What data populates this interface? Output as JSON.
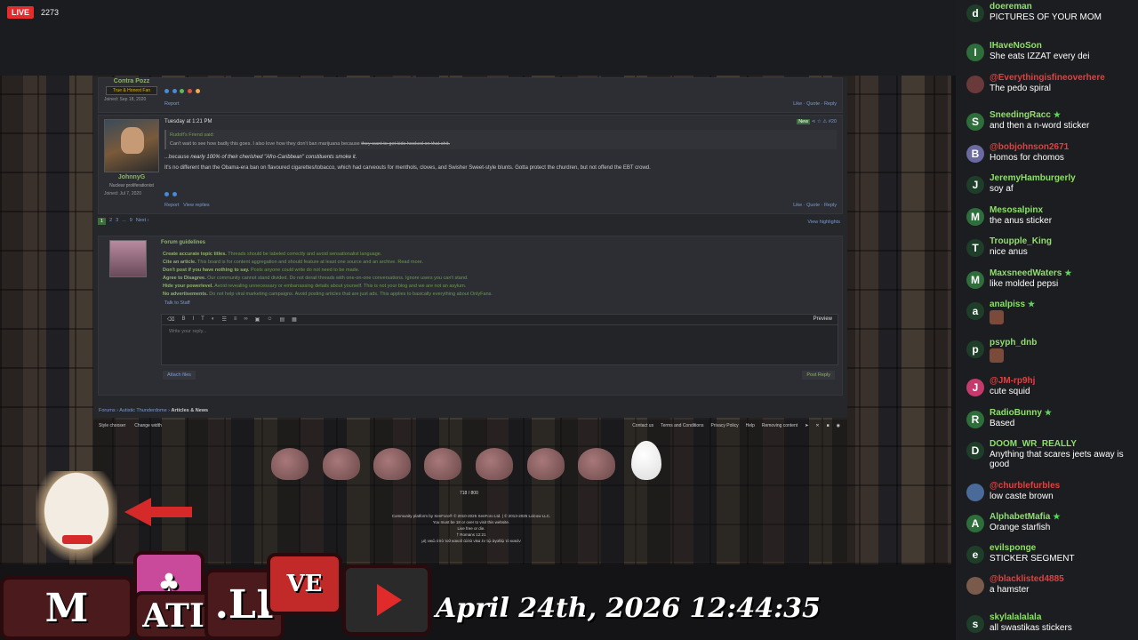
{
  "stream": {
    "live_label": "LIVE",
    "viewer_count": "2273",
    "datetime": "April 24th, 2026 12:44:35",
    "logo_letters": [
      "M",
      "ATI",
      ".LI",
      "VE"
    ]
  },
  "forum": {
    "post1": {
      "username": "Contra Pozz",
      "role": "True & Honest Fan",
      "joined_label": "Joined:",
      "joined_date": "Sep 18, 2020",
      "report": "Report",
      "like": "Like",
      "quote": "Quote",
      "reply": "Reply"
    },
    "post2": {
      "username": "JohnnyG",
      "role": "Nuclear proliferationist",
      "joined_label": "Joined:",
      "joined_date": "Jul 7, 2020",
      "timestamp": "Tuesday at 1:21 PM",
      "badge": "New",
      "number": "#20",
      "quote_from": "Rudolf's Friend said:",
      "quote_text_plain": "Can't wait to see how badly this goes. I also love how they don't ban marijuana because ",
      "quote_text_strike": "they want to get kids hooked on that shit.",
      "line1_prefix": "...because ",
      "line1_italic": "nearly 100% of their cherished \"Afro-Caribbean\" constituents smoke it.",
      "line2": "It's no different than the Obama-era ban on flavoured cigarettes/tobacco, which had carveouts for menthols, cloves, and Swisher Sweet-style blunts. Gotta protect the churdren, but not offend the EBT crowd.",
      "report": "Report",
      "view_replies": "View replies",
      "like": "Like",
      "quote": "Quote",
      "reply": "Reply"
    },
    "pager": [
      "1",
      "2",
      "3",
      "...",
      "9",
      "Next ›"
    ],
    "view_highlights": "View highlights",
    "guidelines": {
      "title": "Forum guidelines",
      "items": [
        {
          "head": "Create accurate topic titles.",
          "text": "Threads should be labeled correctly and avoid sensationalist language."
        },
        {
          "head": "Cite an article.",
          "text": "This board is for content aggregation and should feature at least one source and an archive. Read more."
        },
        {
          "head": "Don't post if you have nothing to say.",
          "text": "Posts anyone could write do not need to be made."
        },
        {
          "head": "Agree to Disagree.",
          "text": "Our community cannot stand divided. Do not derail threads with one-on-one conversations. Ignore users you can't stand."
        },
        {
          "head": "Hide your powerlevel.",
          "text": "Avoid revealing unnecessary or embarrassing details about yourself. This is not your blog and we are not an asylum."
        },
        {
          "head": "No advertisements.",
          "text": "Do not help viral marketing campaigns. Avoid posting articles that are just ads. This applies to basically everything about OnlyFans."
        }
      ],
      "talk_to_staff": "Talk to Staff"
    },
    "editor": {
      "placeholder": "Write your reply...",
      "preview": "Preview",
      "attach": "Attach files",
      "post_reply": "Post Reply"
    },
    "breadcrumbs": [
      "Forums",
      "Autistic Thunderdome",
      "Articles & News"
    ]
  },
  "footer": {
    "left_links": [
      "Style chooser",
      "Change width"
    ],
    "right_links": [
      "Contact us",
      "Terms and Conditions",
      "Privacy Policy",
      "Help",
      "Removing content"
    ],
    "counter": "718 / 800",
    "legal": [
      "Community platform by XenForo® © 2010-2025 XenForo Ltd. | © 2013-2025 Lolcow LLC.",
      "You must be 18 or over to visit this website.",
      "Live free or die.",
      "† Romans 12:21",
      "μὴ νικῶ ὑπὸ τοῦ κακοῦ ἀλλὰ νίκα ἐν τῷ ἀγαθῷ τὸ κακόν"
    ]
  },
  "chat": [
    {
      "initial": "d",
      "name": "doereman",
      "text": "PICTURES OF YOUR MOM",
      "name_color": "green",
      "star": false,
      "avatar_color": "#1e3e2a"
    },
    {
      "initial": "I",
      "name": "IHaveNoSon",
      "text": "She eats IZZAT every dei",
      "name_color": "green",
      "star": false,
      "avatar_color": "#2d6e3a"
    },
    {
      "initial": "",
      "name": "@Everythingisfineoverhere",
      "text": "The pedo spiral",
      "name_color": "red",
      "star": false,
      "avatar_color": "#6a3a3a"
    },
    {
      "initial": "S",
      "name": "SneedingRacc",
      "text": "and then a n-word sticker",
      "name_color": "green",
      "star": true,
      "avatar_color": "#2d6e3a"
    },
    {
      "initial": "B",
      "name": "@bobjohnson2671",
      "text": "Homos for chomos",
      "name_color": "red",
      "star": false,
      "avatar_color": "#6a6aa0"
    },
    {
      "initial": "J",
      "name": "JeremyHamburgerly",
      "text": "soy af",
      "name_color": "green",
      "star": false,
      "avatar_color": "#1e3e2a"
    },
    {
      "initial": "M",
      "name": "Mesosalpinx",
      "text": "the anus sticker",
      "name_color": "green",
      "star": false,
      "avatar_color": "#2d6e3a"
    },
    {
      "initial": "T",
      "name": "Troupple_King",
      "text": "nice anus",
      "name_color": "green",
      "star": false,
      "avatar_color": "#1e3e2a"
    },
    {
      "initial": "M",
      "name": "MaxsneedWaters",
      "text": "like molded pepsi",
      "name_color": "green",
      "star": true,
      "avatar_color": "#2d6e3a"
    },
    {
      "initial": "a",
      "name": "analpiss",
      "text": "",
      "name_color": "green",
      "star": true,
      "avatar_color": "#1e3e2a"
    },
    {
      "initial": "p",
      "name": "psyph_dnb",
      "text": "",
      "name_color": "green",
      "star": false,
      "avatar_color": "#1e3e2a"
    },
    {
      "initial": "J",
      "name": "@JM-rp9hj",
      "text": "cute squid",
      "name_color": "red",
      "star": false,
      "avatar_color": "#c43a6a"
    },
    {
      "initial": "R",
      "name": "RadioBunny",
      "text": "Based",
      "name_color": "green",
      "star": true,
      "avatar_color": "#2d6e3a"
    },
    {
      "initial": "D",
      "name": "DOOM_WR_REALLY",
      "text": "Anything that scares jeets away is good",
      "name_color": "green",
      "star": false,
      "avatar_color": "#1e3e2a"
    },
    {
      "initial": "",
      "name": "@churblefurbles",
      "text": "low caste brown",
      "name_color": "red",
      "star": false,
      "avatar_color": "#4a6a9a"
    },
    {
      "initial": "A",
      "name": "AlphabetMafia",
      "text": "Orange starfish",
      "name_color": "green",
      "star": true,
      "avatar_color": "#2d6e3a"
    },
    {
      "initial": "e",
      "name": "evilsponge",
      "text": "STICKER SEGMENT",
      "name_color": "green",
      "star": false,
      "avatar_color": "#1e3e2a"
    },
    {
      "initial": "",
      "name": "@blacklisted4885",
      "text": "a hamster",
      "name_color": "red",
      "star": false,
      "avatar_color": "#7a5a4a"
    },
    {
      "initial": "s",
      "name": "skylalalalala",
      "text": "all swastikas stickers",
      "name_color": "green",
      "star": false,
      "avatar_color": "#1e3e2a"
    }
  ]
}
